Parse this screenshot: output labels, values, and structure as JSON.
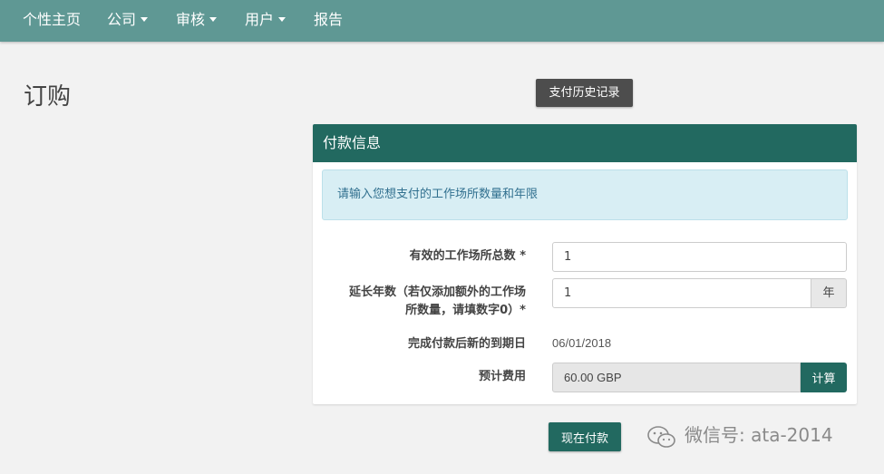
{
  "nav": {
    "items": [
      {
        "label": "个性主页",
        "dropdown": false
      },
      {
        "label": "公司",
        "dropdown": true
      },
      {
        "label": "审核",
        "dropdown": true
      },
      {
        "label": "用户",
        "dropdown": true
      },
      {
        "label": "报告",
        "dropdown": false
      }
    ]
  },
  "page": {
    "title": "订购",
    "history_button": "支付历史记录"
  },
  "panel": {
    "header": "付款信息",
    "alert": "请输入您想支付的工作场所数量和年限",
    "fields": {
      "workplaces": {
        "label": "有效的工作场所总数 *",
        "value": "1"
      },
      "years": {
        "label_line1": "延长年数（若仅添加额外的工作场",
        "label_line2": "所数量，请填数字0）*",
        "value": "1",
        "addon": "年"
      },
      "expiry": {
        "label": "完成付款后新的到期日",
        "value": "06/01/2018"
      },
      "cost": {
        "label": "预计费用",
        "value": "60.00 GBP",
        "calc_button": "计算"
      }
    }
  },
  "pay_button": "现在付款",
  "watermark": "微信号: ata-2014",
  "colors": {
    "navbar": "#5f9894",
    "primary": "#226960",
    "alert_bg": "#d8eef4",
    "history_button": "#4d4d4d"
  }
}
